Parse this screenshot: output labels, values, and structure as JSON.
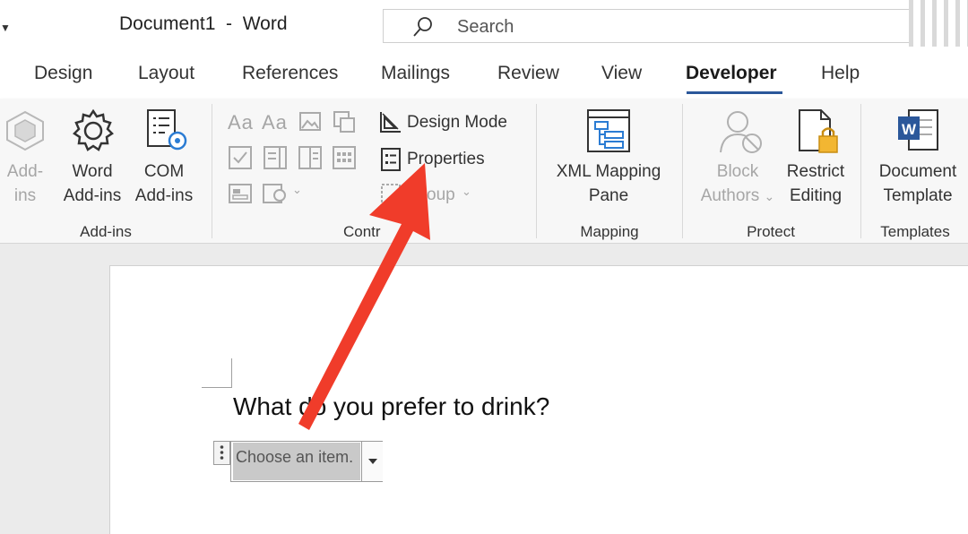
{
  "titlebar": {
    "title": "Document1  -  Word",
    "search_placeholder": "Search"
  },
  "tabs": [
    {
      "label": "Design"
    },
    {
      "label": "Layout"
    },
    {
      "label": "References"
    },
    {
      "label": "Mailings"
    },
    {
      "label": "Review"
    },
    {
      "label": "View"
    },
    {
      "label": "Developer",
      "active": true
    },
    {
      "label": "Help"
    }
  ],
  "ribbon": {
    "addins": {
      "label": "Add-ins",
      "addins_line1": "Add-",
      "addins_line2": "ins",
      "word_line1": "Word",
      "word_line2": "Add-ins",
      "com_line1": "COM",
      "com_line2": "Add-ins"
    },
    "controls": {
      "label": "Contr",
      "design_mode": "Design Mode",
      "properties": "Properties",
      "group": "oup"
    },
    "mapping": {
      "label": "Mapping",
      "xml_line1": "XML Mapping",
      "xml_line2": "Pane"
    },
    "protect": {
      "label": "Protect",
      "block_line1": "Block",
      "block_line2": "Authors",
      "restrict_line1": "Restrict",
      "restrict_line2": "Editing"
    },
    "templates": {
      "label": "Templates",
      "doc_line1": "Document",
      "doc_line2": "Template"
    }
  },
  "document": {
    "question": "What do you prefer to drink?",
    "dropdown_placeholder": "Choose an item."
  },
  "colors": {
    "accent": "#2b579a",
    "arrow": "#f03c2a",
    "word_blue": "#2b579a",
    "lock": "#f2b632"
  }
}
